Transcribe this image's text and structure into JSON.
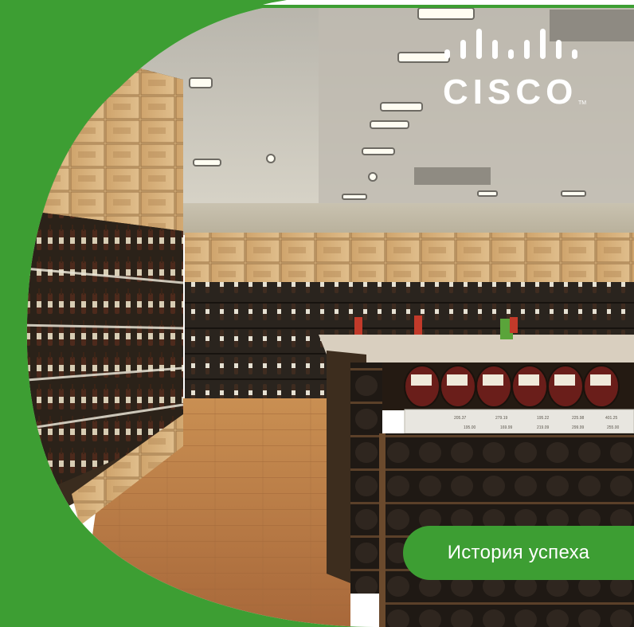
{
  "brand": {
    "logo_word": "CISCO",
    "logo_tm": "TM",
    "logo_icon": "cisco-bridge-bars-icon",
    "accent_green": "#3d9e33"
  },
  "badge": {
    "label": "История успеха"
  },
  "photo": {
    "subject": "wine-store-interior"
  },
  "price_tags": [
    "205.37",
    "279.19",
    "195.22",
    "225.98",
    "401.25",
    "195.00",
    "169.99",
    "219.09",
    "299.99",
    "255.00"
  ]
}
